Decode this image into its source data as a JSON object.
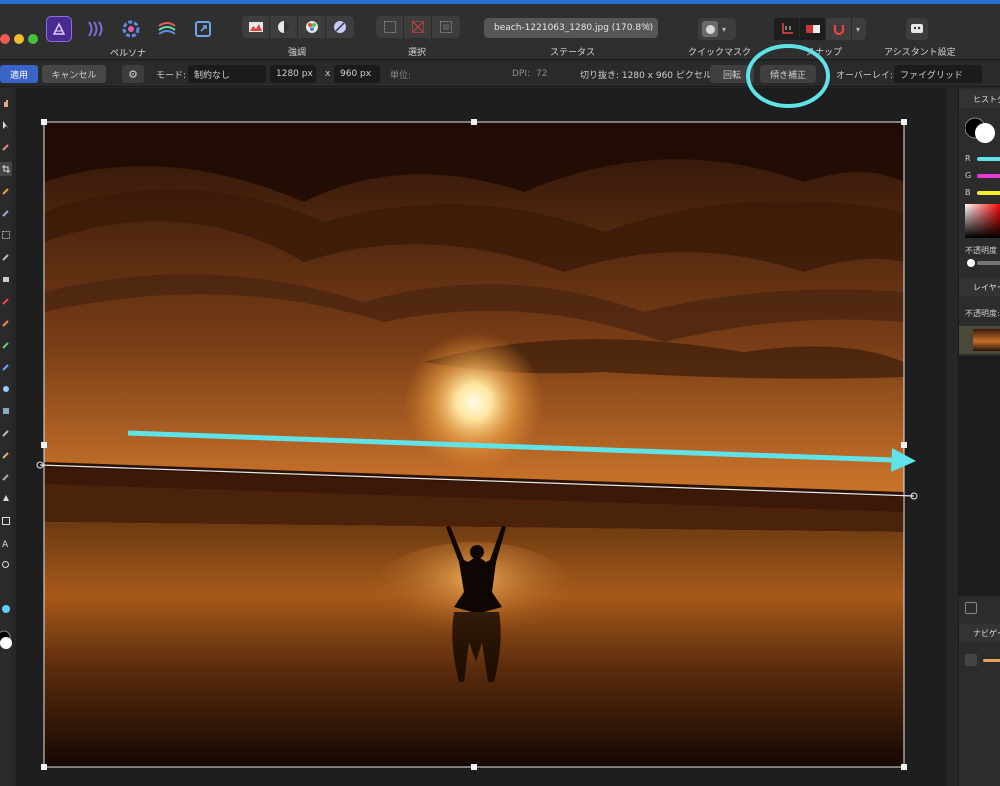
{
  "toolbar": {
    "persona_label": "ペルソナ",
    "groups": [
      {
        "label": "強調"
      },
      {
        "label": "選択"
      },
      {
        "label": "ステータス"
      },
      {
        "label": "クイックマスク"
      },
      {
        "label": "スナップ"
      },
      {
        "label": "アシスタント設定"
      }
    ],
    "document_tab": "beach-1221063_1280.jpg (170.8%)",
    "tab_star": "★"
  },
  "context": {
    "apply": "適用",
    "cancel": "キャンセル",
    "mode_label": "モード:",
    "mode_value": "制約なし",
    "width": "1280 px",
    "times": "x",
    "height": "960 px",
    "unit_label": "単位:",
    "dpi_label": "DPI:",
    "dpi_value": "72",
    "crop_info": "切り抜き: 1280 x 960 ピクセル",
    "rotate": "回転",
    "straighten": "傾き補正",
    "overlay_label": "オーバーレイ:",
    "overlay_value": "ファイグリッド"
  },
  "right_panel": {
    "histogram": "ヒストグラム",
    "r": "R",
    "g": "G",
    "b": "B",
    "opacity_label": "不透明度",
    "layers": "レイヤー",
    "layer_opacity": "不透明度:",
    "navigator": "ナビゲーター"
  },
  "colors": {
    "accent": "#3a64c8",
    "annotation": "#5fe3e8",
    "slider_r": "#5fe3e8",
    "slider_g": "#e63ad8",
    "slider_b": "#f4ef2a"
  }
}
